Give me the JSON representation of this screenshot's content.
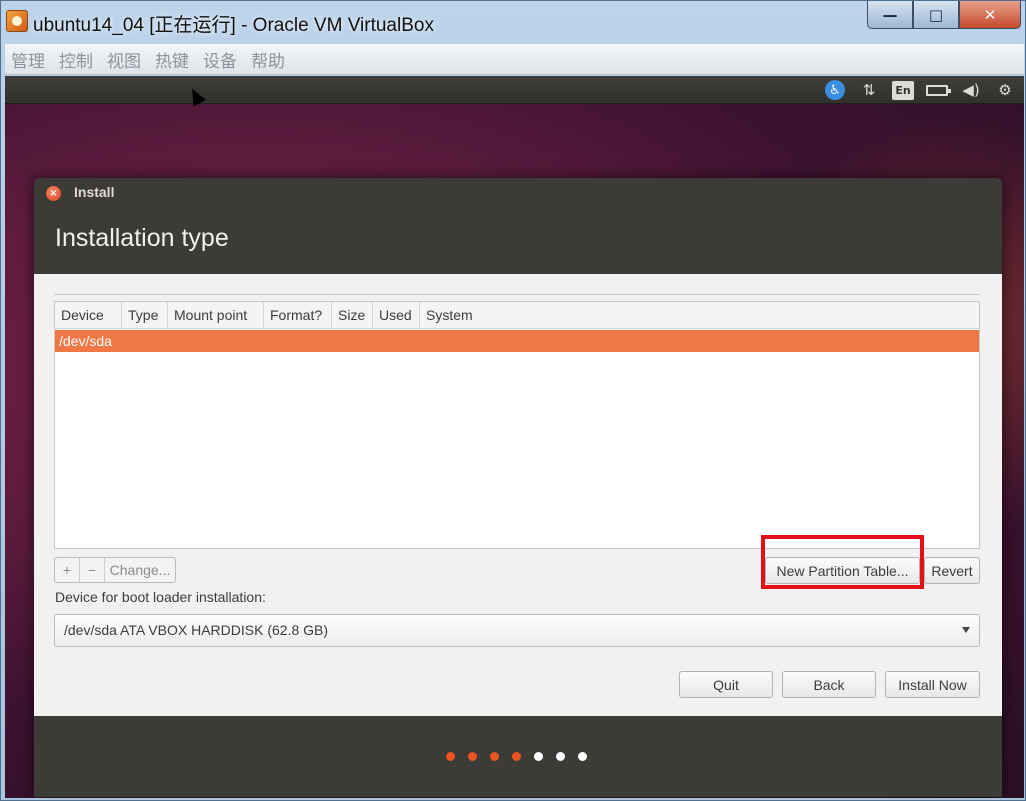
{
  "window": {
    "title": "ubuntu14_04 [正在运行] - Oracle VM VirtualBox",
    "minimize": "—",
    "maximize": "□",
    "close": "✕"
  },
  "menu": [
    "管理",
    "控制",
    "视图",
    "热键",
    "设备",
    "帮助"
  ],
  "guest_panel": {
    "tray_icons": [
      "accessibility-icon",
      "network-icon",
      "keyboard-language-icon",
      "battery-icon",
      "volume-icon",
      "settings-icon"
    ],
    "language": "En",
    "accessibility_glyph": "♿",
    "network_glyph": "⇅",
    "volume_glyph": "◀)",
    "settings_glyph": "⚙"
  },
  "dialog": {
    "window_title": "Install",
    "close_glyph": "×",
    "heading": "Installation type",
    "table": {
      "columns": [
        "Device",
        "Type",
        "Mount point",
        "Format?",
        "Size",
        "Used",
        "System"
      ],
      "rows": [
        {
          "device": "/dev/sda",
          "selected": true
        }
      ]
    },
    "toolbar": {
      "add": "+",
      "remove": "−",
      "change": "Change..."
    },
    "new_partition_table": "New Partition Table...",
    "revert": "Revert",
    "boot_loader_label": "Device for boot loader installation:",
    "boot_loader_value": "/dev/sda  ATA VBOX HARDDISK (62.8 GB)",
    "buttons": {
      "quit": "Quit",
      "back": "Back",
      "install_now": "Install Now"
    },
    "progress_dots": {
      "total": 7,
      "completed": 4,
      "active_color": "#e95420",
      "inactive_color": "#ffffff"
    }
  }
}
